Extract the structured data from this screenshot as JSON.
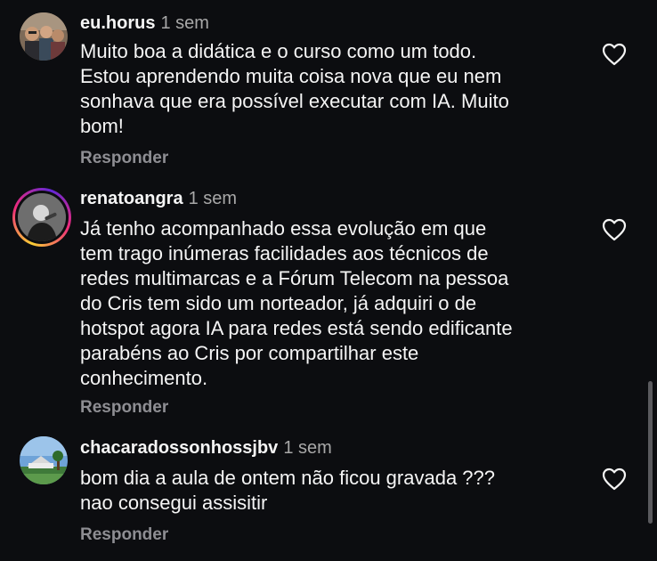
{
  "comments": [
    {
      "username": "eu.horus",
      "time": "1 sem",
      "lines": [
        "Muito boa a didática e o curso como um todo.",
        "Estou aprendendo muita coisa nova que eu nem",
        "sonhava que era possível executar com IA. Muito",
        "bom!"
      ],
      "reply_label": "Responder",
      "avatar": "group-photo-avatar",
      "like_icon": "heart-outline-icon"
    },
    {
      "username": "renatoangra",
      "time": "1 sem",
      "lines": [
        "Já tenho acompanhado essa evolução em que",
        "tem trago inúmeras facilidades aos técnicos de",
        "redes multimarcas e a Fórum Telecom na pessoa",
        "do Cris tem sido um norteador, já adquiri o de",
        "hotspot agora IA para redes está sendo edificante",
        "parabéns ao Cris por compartilhar este",
        "conhecimento."
      ],
      "reply_label": "Responder",
      "avatar": "singer-photo-avatar-with-story-ring",
      "like_icon": "heart-outline-icon"
    },
    {
      "username": "chacaradossonhossjbv",
      "time": "1 sem",
      "lines": [
        "bom dia a aula de ontem não ficou gravada ???",
        "nao consegui assisitir"
      ],
      "reply_label": "Responder",
      "avatar": "landscape-photo-avatar",
      "like_icon": "heart-outline-icon"
    }
  ],
  "colors": {
    "background": "#0c0d10",
    "text": "#f5f5f5",
    "secondary": "#a8a8a8",
    "reply": "#8e8e93"
  }
}
